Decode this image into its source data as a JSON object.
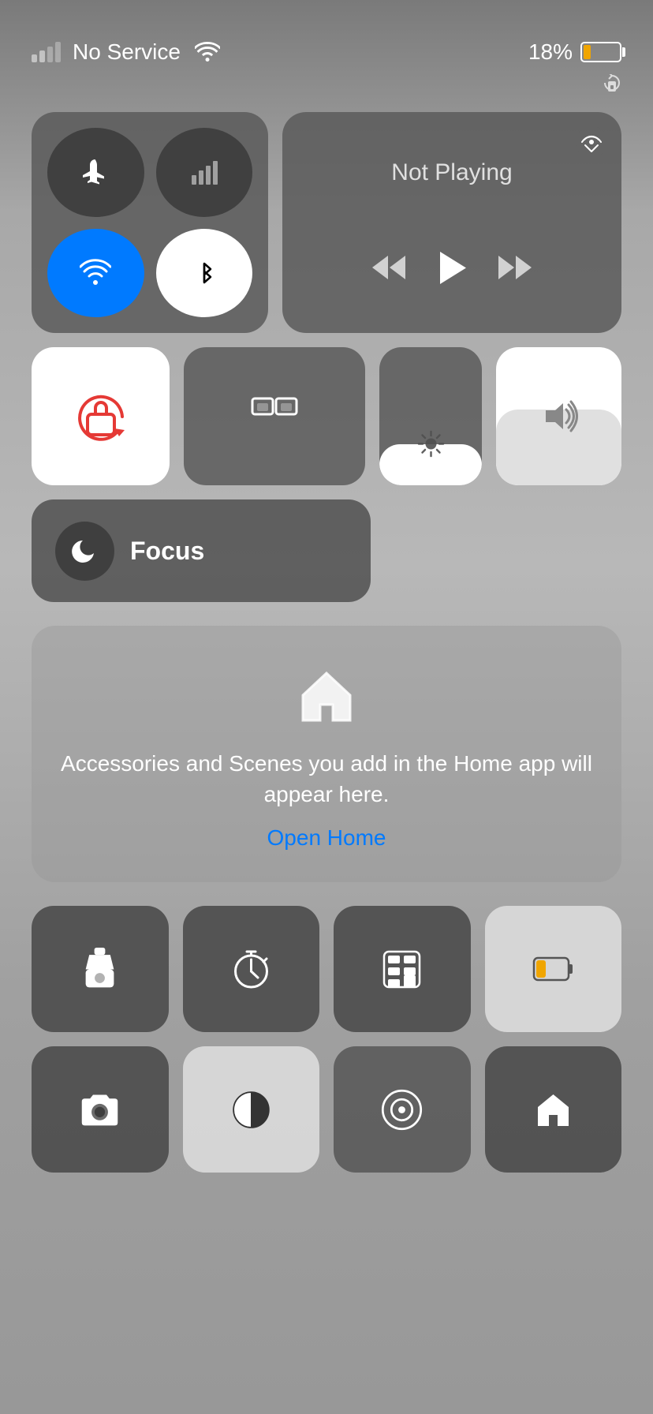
{
  "statusBar": {
    "noService": "No Service",
    "batteryPercent": "18%",
    "batteryLevel": 18
  },
  "connectivity": {
    "airplaneMode": "airplane-mode",
    "cellular": "cellular",
    "wifi": "wifi-on",
    "bluetooth": "bluetooth"
  },
  "nowPlaying": {
    "title": "Not Playing",
    "airplayLabel": "airplay",
    "rewindLabel": "rewind",
    "playLabel": "play",
    "forwardLabel": "fast-forward"
  },
  "controls": {
    "screenLock": "screen-lock",
    "mirror": "screen-mirror",
    "brightness": "brightness",
    "volume": "volume"
  },
  "focus": {
    "label": "Focus"
  },
  "home": {
    "description": "Accessories and Scenes you add in the Home app will appear here.",
    "openLink": "Open Home"
  },
  "bottomRow1": {
    "flashlight": "flashlight",
    "timer": "timer",
    "calculator": "calculator",
    "battery": "battery"
  },
  "bottomRow2": {
    "camera": "camera",
    "darkMode": "dark-mode",
    "portrait": "portrait",
    "homeApp": "home-app"
  }
}
